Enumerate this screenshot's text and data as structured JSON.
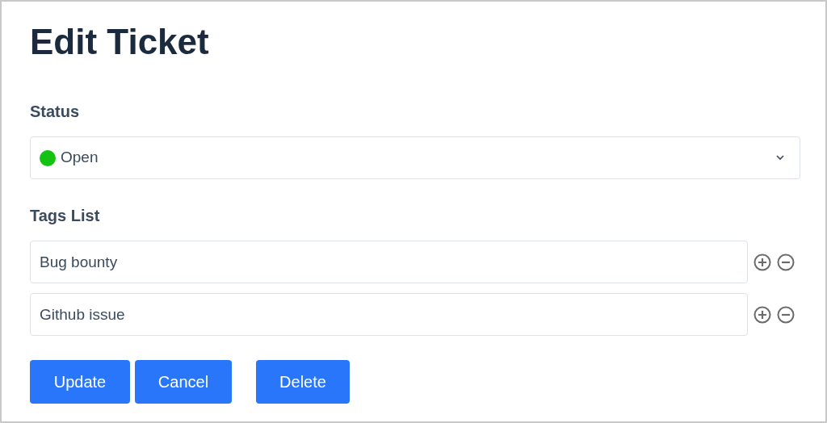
{
  "title": "Edit Ticket",
  "status": {
    "label": "Status",
    "value": "Open",
    "color": "#13c213"
  },
  "tags": {
    "label": "Tags List",
    "items": [
      {
        "value": "Bug bounty"
      },
      {
        "value": "Github issue"
      }
    ]
  },
  "buttons": [
    {
      "label": "Update"
    },
    {
      "label": "Cancel"
    },
    {
      "label": "Delete"
    }
  ]
}
